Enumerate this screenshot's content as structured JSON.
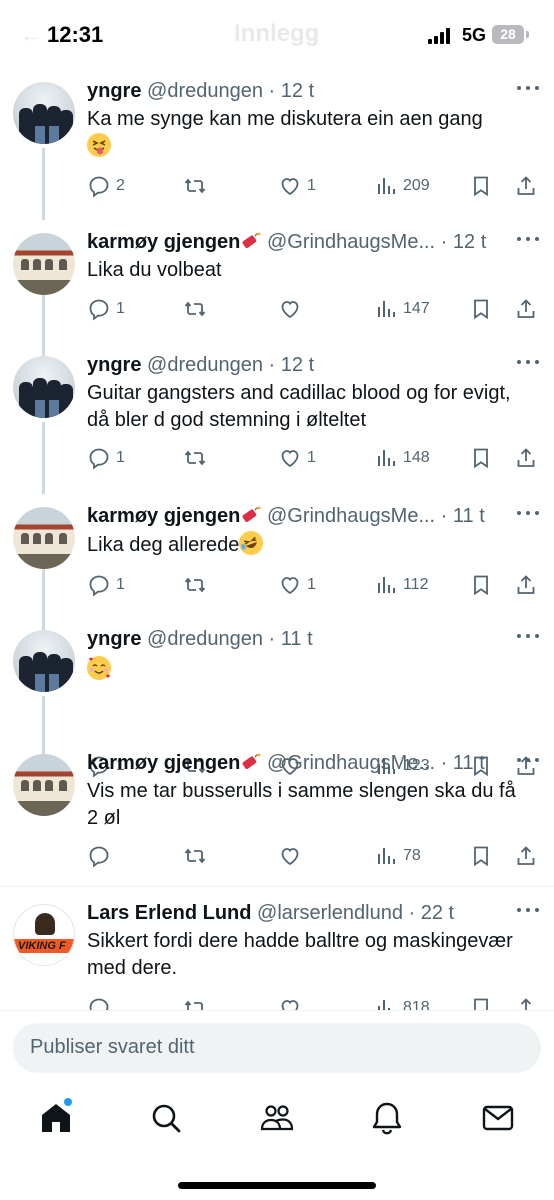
{
  "status": {
    "time": "12:31",
    "network": "5G",
    "battery": "28"
  },
  "header": {
    "title": "Innlegg"
  },
  "tweets": [
    {
      "name": "yngre",
      "handle": "@dredungen",
      "sep": " · ",
      "time": "12 t",
      "text": "Ka me synge kan me diskutera ein aen gang",
      "emoji": "squinting-tongue-face",
      "replies": "2",
      "retweets": "",
      "likes": "1",
      "views": "209",
      "avatar": "group-photo"
    },
    {
      "name": "karmøy gjengen",
      "badge": "firecracker-emoji",
      "handle": "@GrindhaugsMe...",
      "sep": " · ",
      "time": "12 t",
      "text": "Lika du volbeat",
      "replies": "1",
      "retweets": "",
      "likes": "",
      "views": "147",
      "avatar": "building-photo"
    },
    {
      "name": "yngre",
      "handle": "@dredungen",
      "sep": " · ",
      "time": "12 t",
      "text": "Guitar gangsters and cadillac blood og for evigt, då bler d god stemning i ølteltet",
      "replies": "1",
      "retweets": "",
      "likes": "1",
      "views": "148",
      "avatar": "group-photo"
    },
    {
      "name": "karmøy gjengen",
      "badge": "firecracker-emoji",
      "handle": "@GrindhaugsMe...",
      "sep": " · ",
      "time": "11 t",
      "text": "Lika deg allerede",
      "emoji": "rolling-laughing-face",
      "replies": "1",
      "retweets": "",
      "likes": "1",
      "views": "112",
      "avatar": "building-photo"
    },
    {
      "name": "yngre",
      "handle": "@dredungen",
      "sep": " · ",
      "time": "11 t",
      "text": "",
      "emoji": "smiling-face-with-hearts",
      "replies": "1",
      "retweets": "",
      "likes": "",
      "views": "123",
      "avatar": "group-photo"
    },
    {
      "name": "karmøy gjengen",
      "badge": "firecracker-emoji",
      "handle": "@GrindhaugsMe...",
      "sep": " · ",
      "time": "11 t",
      "text": "Vis me tar busserulls i samme slengen ska du få 2 øl",
      "replies": "",
      "retweets": "",
      "likes": "",
      "views": "78",
      "avatar": "building-photo"
    },
    {
      "name": "Lars Erlend Lund",
      "handle": "@larserlendlund",
      "sep": " · ",
      "time": "22 t",
      "text": "Sikkert fordi dere hadde balltre og maskingevær med dere.",
      "replies": "",
      "retweets": "",
      "likes": "",
      "views": "818",
      "avatar": "viking-logo",
      "avatar_text": "VIKING F"
    }
  ],
  "composer": {
    "placeholder": "Publiser svaret ditt"
  },
  "tabs": [
    "home-icon",
    "search-icon",
    "communities-icon",
    "notifications-icon",
    "messages-icon"
  ],
  "colors": {
    "text": "#0f1419",
    "secondary": "#536471",
    "accent": "#1d9bf0",
    "thread_line": "#cfd9de"
  }
}
